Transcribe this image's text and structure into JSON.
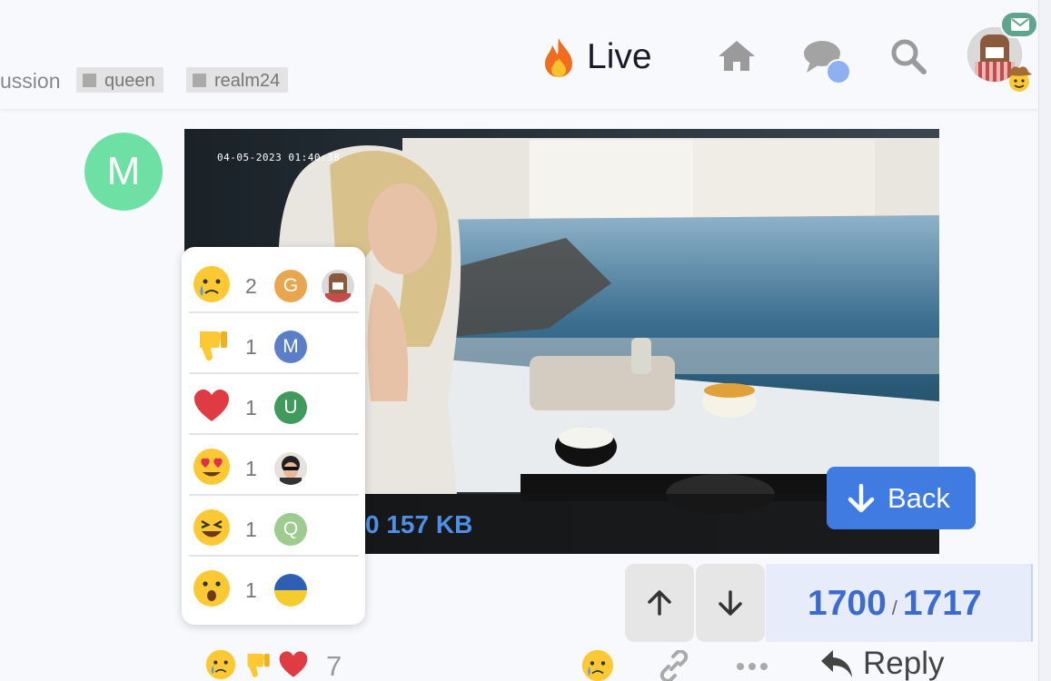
{
  "header": {
    "breadcrumb": "ussion",
    "tags": [
      "queen",
      "realm24"
    ],
    "live_label": "Live",
    "icons": [
      "fire-icon",
      "home-icon",
      "chat-icon",
      "search-icon",
      "mail-icon"
    ],
    "colors": {
      "accent": "#3f7be0",
      "mail_badge": "#5fa58e",
      "unread_dot": "#8fb0f0"
    }
  },
  "post": {
    "author_initial": "M",
    "author_color": "#6fe0a3",
    "image": {
      "timestamp": "04-05-2023 01:40:38",
      "meta": "0 157 KB"
    }
  },
  "reactions": {
    "items": [
      {
        "emoji": "crying-face",
        "count": "2",
        "users": [
          "G",
          "avatar"
        ]
      },
      {
        "emoji": "thumbs-down",
        "count": "1",
        "users": [
          "M"
        ]
      },
      {
        "emoji": "red-heart",
        "count": "1",
        "users": [
          "U"
        ]
      },
      {
        "emoji": "heart-eyes",
        "count": "1",
        "users": [
          "avatar"
        ]
      },
      {
        "emoji": "laughing-face",
        "count": "1",
        "users": [
          "Q"
        ]
      },
      {
        "emoji": "surprised-face",
        "count": "1",
        "users": [
          "flag"
        ]
      }
    ],
    "user_colors": {
      "G": "#e8a64e",
      "M": "#5b7ec8",
      "U": "#3f9a5b",
      "Q": "#9ecb8e"
    },
    "total": "7"
  },
  "back_button": {
    "label": "Back"
  },
  "timeline": {
    "current": "1700",
    "separator": "/",
    "total": "1717"
  },
  "actions": {
    "reply_label": "Reply"
  }
}
